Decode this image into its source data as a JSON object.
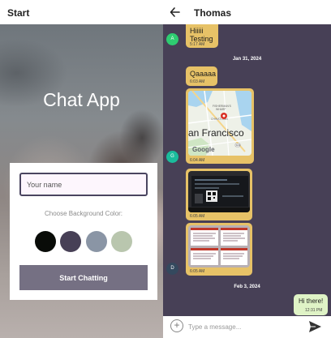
{
  "start_screen": {
    "header_title": "Start",
    "app_title": "Chat App",
    "name_placeholder": "Your name",
    "choose_color_label": "Choose Background Color:",
    "colors": [
      "#090C08",
      "#474056",
      "#8A95A5",
      "#B9C6AE"
    ],
    "start_button_label": "Start Chatting"
  },
  "chat_screen": {
    "header_title": "Thomas",
    "messages": [
      {
        "text_lines": [
          "Hiiiii",
          "Testing"
        ],
        "time": "5:17 AM",
        "avatar": "A"
      },
      {
        "date": "Jan 31, 2024"
      },
      {
        "text": "Qaaaaa",
        "time": "6:03 AM"
      },
      {
        "map_label": "an Francisco",
        "google_label": "Google",
        "time": "6:04 AM",
        "avatar": "G"
      },
      {
        "time": "6:05 AM"
      },
      {
        "time": "6:05 AM",
        "avatar": "D"
      },
      {
        "date": "Feb 3, 2024"
      },
      {
        "text": "Hi there!",
        "time": "12:31 PM",
        "own": true
      }
    ],
    "composer_placeholder": "Type a message..."
  },
  "theme": {
    "chat_background": "#474056",
    "incoming_bubble": "#E7C267",
    "outgoing_bubble": "#DFF3C6",
    "avatar_a": "#2ECC71",
    "avatar_g": "#1ABC9C",
    "avatar_d": "#34495E"
  }
}
